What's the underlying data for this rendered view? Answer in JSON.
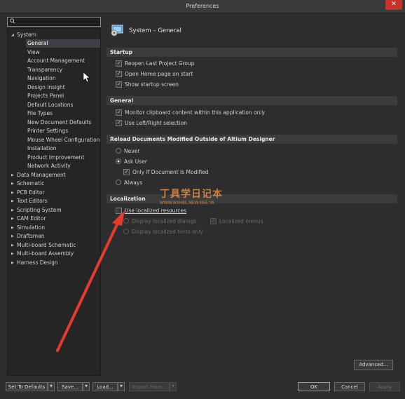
{
  "window": {
    "title": "Preferences",
    "close_glyph": "✕"
  },
  "search": {
    "value": "",
    "placeholder": ""
  },
  "tree": {
    "system": "System",
    "system_children": [
      "General",
      "View",
      "Account Management",
      "Transparency",
      "Navigation",
      "Design Insight",
      "Projects Panel",
      "Default Locations",
      "File Types",
      "New Document Defaults",
      "Printer Settings",
      "Mouse Wheel Configuration",
      "Installation",
      "Product Improvement",
      "Network Activity"
    ],
    "others": [
      "Data Management",
      "Schematic",
      "PCB Editor",
      "Text Editors",
      "Scripting System",
      "CAM Editor",
      "Simulation",
      "Draftsman",
      "Multi-board Schematic",
      "Multi-board Assembly",
      "Harness Design"
    ]
  },
  "page": {
    "title": "System – General"
  },
  "startup": {
    "header": "Startup",
    "options": [
      "Reopen Last Project Group",
      "Open Home page on start",
      "Show startup screen"
    ]
  },
  "general": {
    "header": "General",
    "options": [
      "Monitor clipboard content within this application only",
      "Use Left/Right selection"
    ]
  },
  "reload": {
    "header": "Reload Documents Modified Outside of Altium Designer",
    "never": "Never",
    "ask_user": "Ask User",
    "only_if_modified": "Only If Document Is Modified",
    "always": "Always"
  },
  "localization": {
    "header": "Localization",
    "use_localized": "Use localized resources",
    "display_dialogs": "Display localized dialogs",
    "localized_menus": "Localized menus",
    "display_hints": "Display localized hints only"
  },
  "watermark": {
    "line1": "丁具学日记本",
    "line2": "WWW.NXH8L.NEW.NEE.YA"
  },
  "buttons": {
    "advanced": "Advanced...",
    "set_defaults": "Set To Defaults",
    "save": "Save...",
    "load": "Load...",
    "import_from": "Import From...",
    "ok": "OK",
    "cancel": "Cancel",
    "apply": "Apply"
  },
  "colors": {
    "accent_arrow": "#e53b2c",
    "close_red": "#c7322b",
    "watermark": "#ff9a40"
  }
}
